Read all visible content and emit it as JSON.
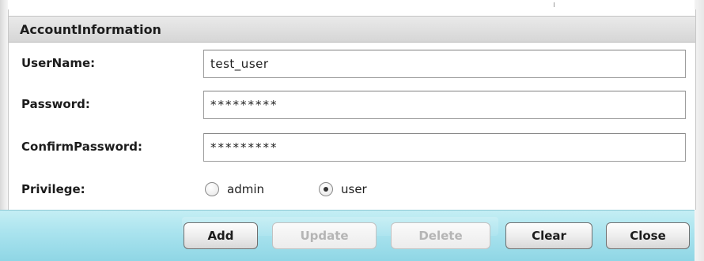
{
  "section": {
    "title": "AccountInformation"
  },
  "fields": {
    "username": {
      "label": "UserName:",
      "value": "test_user"
    },
    "password": {
      "label": "Password:",
      "value": "*********"
    },
    "confirm_password": {
      "label": "ConfirmPassword:",
      "value": "*********"
    }
  },
  "privilege": {
    "label": "Privilege:",
    "options": [
      {
        "label": "admin",
        "selected": false
      },
      {
        "label": "user",
        "selected": true
      }
    ]
  },
  "buttons": {
    "add": {
      "label": "Add",
      "enabled": true
    },
    "update": {
      "label": "Update",
      "enabled": false
    },
    "delete": {
      "label": "Delete",
      "enabled": false
    },
    "clear": {
      "label": "Clear",
      "enabled": true
    },
    "close": {
      "label": "Close",
      "enabled": true
    }
  },
  "colors": {
    "button_bar": "#a9e3ee",
    "header": "#dcdcdc"
  }
}
